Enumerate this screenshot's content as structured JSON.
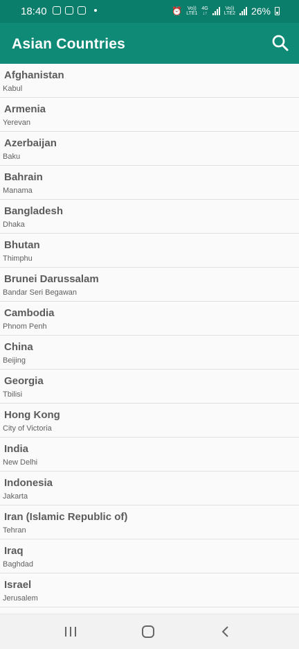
{
  "status_bar": {
    "time": "18:40",
    "net1_top": "Vo))",
    "net1_bottom": "LTE1",
    "net2_top": "4G",
    "net3_top": "Vo))",
    "net3_bottom": "LTE2",
    "battery": "26%"
  },
  "app_bar": {
    "title": "Asian Countries",
    "search_icon": "search-icon"
  },
  "countries": [
    {
      "name": "Afghanistan",
      "capital": "Kabul"
    },
    {
      "name": "Armenia",
      "capital": "Yerevan"
    },
    {
      "name": "Azerbaijan",
      "capital": "Baku"
    },
    {
      "name": "Bahrain",
      "capital": "Manama"
    },
    {
      "name": "Bangladesh",
      "capital": "Dhaka"
    },
    {
      "name": "Bhutan",
      "capital": "Thimphu"
    },
    {
      "name": "Brunei Darussalam",
      "capital": "Bandar Seri Begawan"
    },
    {
      "name": "Cambodia",
      "capital": "Phnom Penh"
    },
    {
      "name": "China",
      "capital": "Beijing"
    },
    {
      "name": "Georgia",
      "capital": "Tbilisi"
    },
    {
      "name": "Hong Kong",
      "capital": "City of Victoria"
    },
    {
      "name": "India",
      "capital": "New Delhi"
    },
    {
      "name": "Indonesia",
      "capital": "Jakarta"
    },
    {
      "name": "Iran (Islamic Republic of)",
      "capital": "Tehran"
    },
    {
      "name": "Iraq",
      "capital": "Baghdad"
    },
    {
      "name": "Israel",
      "capital": "Jerusalem"
    }
  ],
  "nav_bar": {
    "recents_icon": "recents-icon",
    "home_icon": "home-icon",
    "back_icon": "back-icon"
  },
  "colors": {
    "status_bar": "#0b7d6b",
    "app_bar": "#0e8a76",
    "background": "#fafafa"
  }
}
